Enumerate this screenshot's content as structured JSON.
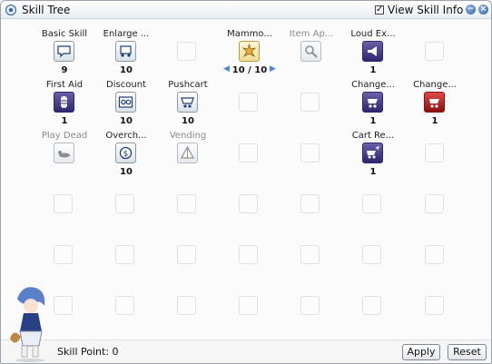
{
  "window": {
    "title": "Skill Tree",
    "view_skill_info": {
      "label": "View Skill Info",
      "checked": true
    },
    "minimize_glyph": "−",
    "close_glyph": "×"
  },
  "skills": [
    {
      "id": "basic-skill",
      "name": "Basic Skill",
      "level": "9",
      "icon": "speech-bubble-icon",
      "disabled": false
    },
    {
      "id": "enlarge",
      "name": "Enlarge ...",
      "level": "10",
      "icon": "cart-weight-icon",
      "disabled": false
    },
    {
      "id": "mammonite",
      "name": "Mammo...",
      "level": "10 / 10",
      "icon": "mammonite-burst-icon",
      "disabled": false,
      "stepper": true
    },
    {
      "id": "item-appraisal",
      "name": "Item Ap...",
      "level": "",
      "icon": "magnifier-icon",
      "disabled": true
    },
    {
      "id": "loud-exclamation",
      "name": "Loud Ex...",
      "level": "1",
      "icon": "megaphone-icon",
      "disabled": false
    },
    {
      "id": "first-aid",
      "name": "First Aid",
      "level": "1",
      "icon": "bandaged-hand-icon",
      "disabled": false
    },
    {
      "id": "discount",
      "name": "Discount",
      "level": "10",
      "icon": "discount-tag-icon",
      "disabled": false
    },
    {
      "id": "pushcart",
      "name": "Pushcart",
      "level": "10",
      "icon": "pushcart-icon",
      "disabled": false
    },
    {
      "id": "change-cart",
      "name": "Change...",
      "level": "1",
      "icon": "change-cart-icon",
      "disabled": false
    },
    {
      "id": "change-cart-2",
      "name": "Change...",
      "level": "1",
      "icon": "red-cart-icon",
      "disabled": false
    },
    {
      "id": "play-dead",
      "name": "Play Dead",
      "level": "",
      "icon": "lying-figure-icon",
      "disabled": true
    },
    {
      "id": "overcharge",
      "name": "Overch...",
      "level": "10",
      "icon": "coin-icon",
      "disabled": false
    },
    {
      "id": "vending",
      "name": "Vending",
      "level": "",
      "icon": "vending-tent-icon",
      "disabled": true
    },
    {
      "id": "cart-revolution",
      "name": "Cart Re...",
      "level": "1",
      "icon": "cart-revolution-icon",
      "disabled": false
    }
  ],
  "footer": {
    "skill_point_label": "Skill Point: 0",
    "apply_label": "Apply",
    "reset_label": "Reset"
  },
  "colors": {
    "accent": "#2f5f95",
    "stepper_arrow": "#4a86d4"
  }
}
